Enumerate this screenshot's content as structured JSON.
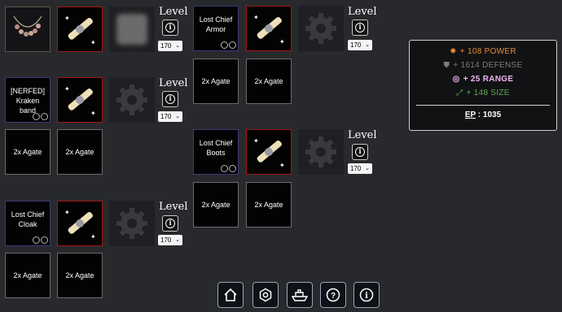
{
  "level": {
    "label": "Level",
    "value": "170"
  },
  "items": {
    "necklace": {
      "name": "necklace"
    },
    "kraken_band": {
      "name": "[NERFED]\nKraken band"
    },
    "chief_cloak": {
      "name": "Lost Chief\nCloak"
    },
    "chief_armor": {
      "name": "Lost Chief\nArmor"
    },
    "chief_boots": {
      "name": "Lost Chief\nBoots"
    }
  },
  "gem_label": "2x Agate",
  "stats": {
    "power": "+ 108 POWER",
    "defense": "+ 1614 DEFENSE",
    "range": "+ 25 RANGE",
    "size": "+ 148 SIZE",
    "ep_label": "EP",
    "ep_value": ": 1035"
  },
  "colors": {
    "power": "#f08a2e",
    "defense": "#7c7c7c",
    "range": "#f2b5f5",
    "size": "#5fae4f",
    "slot_red": "#a11818",
    "slot_blue": "#3d3a7a"
  },
  "nav": [
    "home-icon",
    "settings-icon",
    "ship-icon",
    "help-icon",
    "info-icon"
  ]
}
